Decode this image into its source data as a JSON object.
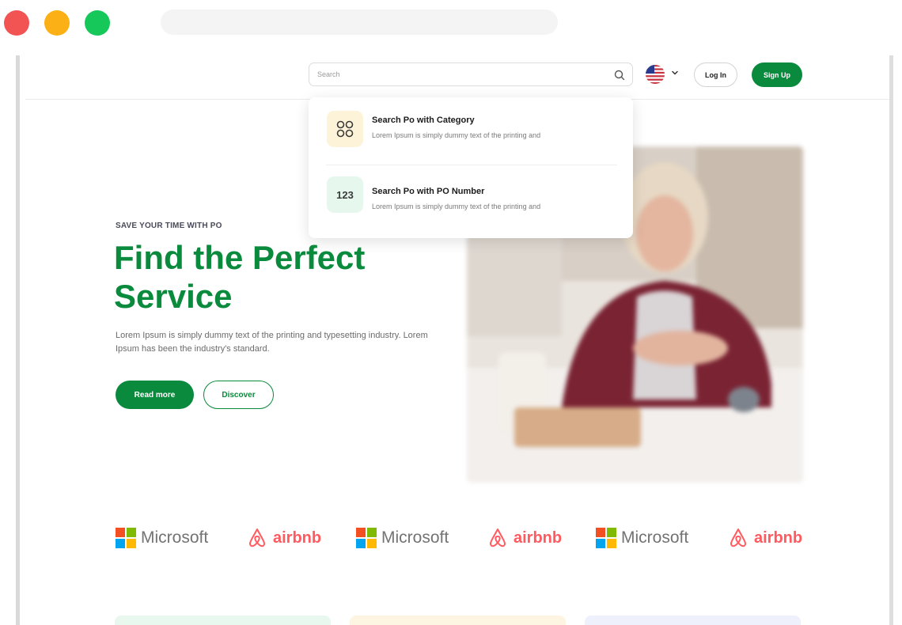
{
  "window": {
    "controls": [
      "close",
      "minimize",
      "maximize"
    ]
  },
  "header": {
    "search": {
      "placeholder": "Search",
      "icon": "search-icon"
    },
    "language": {
      "flag": "us-flag-icon",
      "chevron": "chevron-down-icon"
    },
    "login_label": "Log In",
    "signup_label": "Sign Up"
  },
  "search_dropdown": {
    "items": [
      {
        "icon": "category-grid-icon",
        "title": "Search Po with Category",
        "description": "Lorem Ipsum is simply dummy text of the printing and"
      },
      {
        "icon_text": "123",
        "title": "Search Po with PO Number",
        "description": "Lorem Ipsum is simply dummy text of the printing and"
      }
    ]
  },
  "hero": {
    "eyebrow": "SAVE YOUR TIME WITH PO",
    "headline": "Find the Perfect Service",
    "description": "Lorem Ipsum is simply dummy text of the printing and typesetting industry. Lorem Ipsum has been the industry's standard.",
    "primary_button": "Read more",
    "secondary_button": "Discover"
  },
  "partners": [
    {
      "name": "Microsoft",
      "type": "microsoft"
    },
    {
      "name": "airbnb",
      "type": "airbnb"
    },
    {
      "name": "Microsoft",
      "type": "microsoft"
    },
    {
      "name": "airbnb",
      "type": "airbnb"
    },
    {
      "name": "Microsoft",
      "type": "microsoft"
    },
    {
      "name": "airbnb",
      "type": "airbnb"
    }
  ],
  "colors": {
    "brand_green": "#0a8a3c",
    "airbnb_red": "#ff5a5f",
    "card_tints": [
      "#e9f8ef",
      "#fdf5e2",
      "#eef1fb"
    ]
  }
}
